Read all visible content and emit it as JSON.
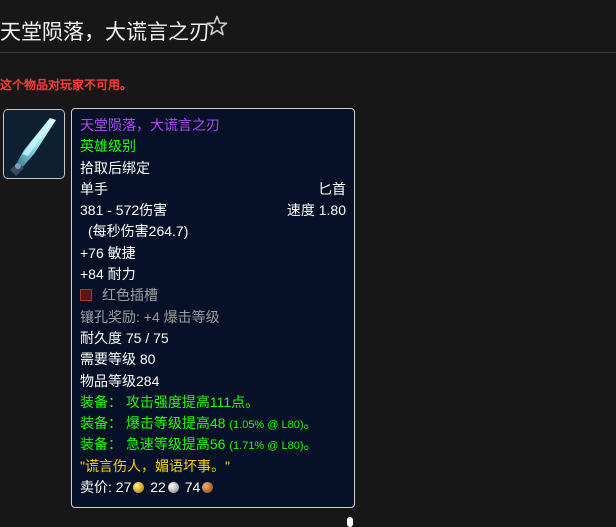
{
  "header": {
    "title": "天堂陨落，大谎言之刃",
    "favorite_icon": "star-outline-icon"
  },
  "warning": "这个物品对玩家不可用。",
  "item_icon": "dagger-icon",
  "tooltip": {
    "name": "天堂陨落，大谎言之刃",
    "quality": "英雄级别",
    "bind": "拾取后绑定",
    "slot": "单手",
    "type": "匕首",
    "damage": "381 - 572伤害",
    "speed": "速度 1.80",
    "dps": "(每秒伤害264.7)",
    "agility": "+76 敏捷",
    "stamina": "+84 耐力",
    "socket": "红色插槽",
    "socket_bonus": "镶孔奖励: +4 爆击等级",
    "durability": "耐久度 75 / 75",
    "required_level": "需要等级 80",
    "item_level": "物品等级284",
    "equip1": "装备： 攻击强度提高111点。",
    "equip2_text": "装备： 爆击等级提高48",
    "equip2_pct": "(1.05% @ L80)",
    "equip2_end": "。",
    "equip3_text": "装备： 急速等级提高56",
    "equip3_pct": "(1.71% @ L80)",
    "equip3_end": "。",
    "flavor": "\"谎言伤人，媚语坏事。\"",
    "sell_label": "卖价:",
    "gold": "27",
    "silver": "22",
    "copper": "74"
  },
  "colors": {
    "epic": "#b048f8",
    "uncommon": "#1eff00",
    "gray": "#9d9d9d",
    "flavor": "#ffd100",
    "warning": "#ff3b3b"
  }
}
